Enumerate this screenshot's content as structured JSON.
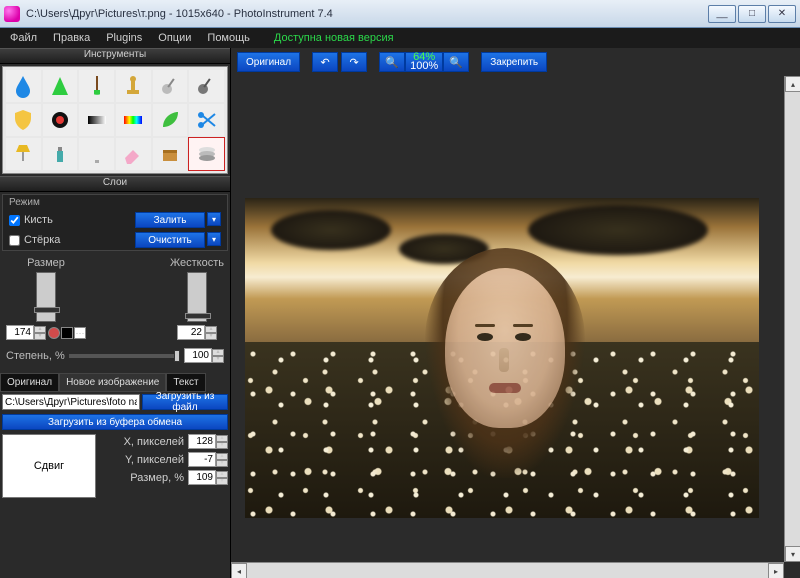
{
  "window": {
    "title": "C:\\Users\\Друг\\Pictures\\т.png - 1015x640 - PhotoInstrument 7.4",
    "min": "__",
    "max": "□",
    "close": "✕"
  },
  "menu": {
    "items": [
      "Файл",
      "Правка",
      "Plugins",
      "Опции",
      "Помощь"
    ],
    "update": "Доступна новая версия"
  },
  "panels": {
    "tools_title": "Инструменты",
    "layers_title": "Слои"
  },
  "tools": [
    "drop",
    "cone",
    "brush",
    "stamp",
    "dodge",
    "smudge",
    "shield",
    "redeye",
    "gradient-bw",
    "gradient-color",
    "leaf",
    "scissors",
    "lamp",
    "spray",
    "bulb",
    "eraser",
    "package",
    "layers"
  ],
  "tools_selected": "layers",
  "mode": {
    "header": "Режим",
    "brush_label": "Кисть",
    "brush_checked": true,
    "erase_label": "Стёрка",
    "erase_checked": false,
    "fill_btn": "Залить",
    "clear_btn": "Очистить"
  },
  "sliders": {
    "size_label": "Размер",
    "size_value": "174",
    "hardness_label": "Жесткость",
    "hardness_value": "22",
    "swatches": [
      "#d14b4b",
      "#000000"
    ]
  },
  "opacity": {
    "label": "Степень, %",
    "value": "100"
  },
  "tabs": {
    "original": "Оригинал",
    "newimg": "Новое изображение",
    "text": "Текст",
    "active": "newimg"
  },
  "file": {
    "path": "C:\\Users\\Друг\\Pictures\\foto na ▾",
    "load_file_btn": "Загрузить из файл",
    "load_clip_btn": "Загрузить из буфера обмена"
  },
  "shift": {
    "button": "Сдвиг",
    "x_label": "X, пикселей",
    "x_value": "128",
    "y_label": "Y, пикселей",
    "y_value": "-7",
    "size_label": "Размер, %",
    "size_value": "109"
  },
  "topbar": {
    "original": "Оригинал",
    "undo": "↶",
    "redo": "↷",
    "zoom_out": "⤵",
    "zoom_pct_top": "64%",
    "zoom_pct_bot": "100%",
    "zoom_in": "⤴",
    "fix": "Закрепить"
  }
}
